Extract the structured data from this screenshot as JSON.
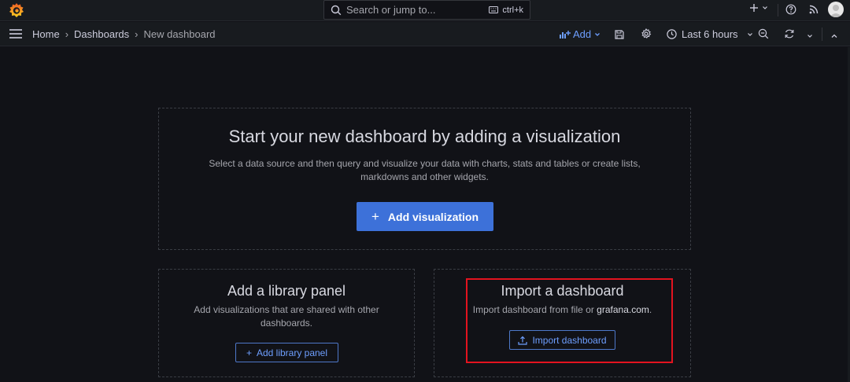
{
  "topbar": {
    "search": {
      "placeholder": "Search or jump to...",
      "shortcut": "ctrl+k"
    },
    "icons": [
      "grafana-logo",
      "keyboard-icon",
      "plus-icon",
      "chevron-down-icon",
      "help-icon",
      "rss-icon",
      "avatar"
    ]
  },
  "breadcrumb": {
    "home": "Home",
    "dashboards": "Dashboards",
    "current": "New dashboard",
    "separator": "›"
  },
  "toolbar": {
    "add_label": "Add",
    "time_range": "Last 6 hours"
  },
  "empty_state": {
    "title": "Start your new dashboard by adding a visualization",
    "description": "Select a data source and then query and visualize your data with charts, stats and tables or create lists, markdowns and other widgets.",
    "button_label": "Add visualization",
    "button_plus": "+"
  },
  "library_panel": {
    "title": "Add a library panel",
    "description": "Add visualizations that are shared with other dashboards.",
    "button_label": "Add library panel",
    "button_plus": "+"
  },
  "import_panel": {
    "title": "Import a dashboard",
    "description_prefix": "Import dashboard from file or ",
    "description_link": "grafana.com",
    "description_suffix": ".",
    "button_label": "Import dashboard"
  },
  "colors": {
    "background": "#111217",
    "bar": "#181b1f",
    "primary": "#3d71d9",
    "link": "#6e9fff",
    "highlight": "#e3131f"
  }
}
